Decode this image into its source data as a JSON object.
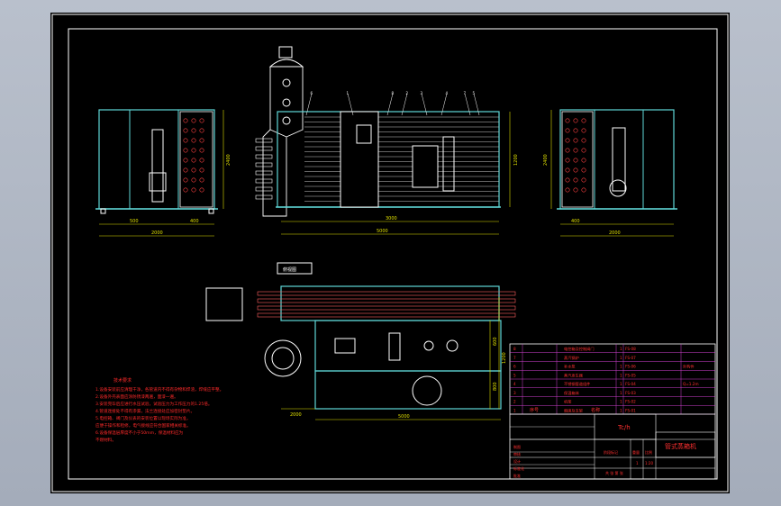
{
  "title_block": {
    "rate_text": "Tc/h",
    "drawing_name": "管式蒸箱机",
    "scale": "1:20",
    "sheet_no": "1",
    "header_labels": [
      "序号",
      "名称"
    ],
    "footer_labels": [
      "制图",
      "审核",
      "设计",
      "标准化",
      "批准"
    ],
    "stage_label": "阶段标记",
    "weight_label": "重量",
    "scale_label": "比例",
    "sheet_label": "共  张  第  张"
  },
  "parts_list": [
    {
      "no": "8",
      "name": "电控箱及控制阀门",
      "code": "FS-08",
      "qty": "1",
      "note": ""
    },
    {
      "no": "7",
      "name": "蒸汽锅炉",
      "code": "FS-07",
      "qty": "1",
      "note": ""
    },
    {
      "no": "6",
      "name": "补水泵",
      "code": "FS-06",
      "qty": "1",
      "note": "外购件"
    },
    {
      "no": "5",
      "name": "蒸汽发生器",
      "code": "FS-05",
      "qty": "1",
      "note": ""
    },
    {
      "no": "4",
      "name": "不锈钢管道组件",
      "code": "FS-04",
      "qty": "1",
      "note": "Q=1.2m"
    },
    {
      "no": "3",
      "name": "保温箱体",
      "code": "FS-03",
      "qty": "1",
      "note": ""
    },
    {
      "no": "2",
      "name": "机架",
      "code": "FS-02",
      "qty": "1",
      "note": ""
    },
    {
      "no": "1",
      "name": "烟囱及支架",
      "code": "FS-01",
      "qty": "1",
      "note": ""
    }
  ],
  "notes": {
    "heading": "技术要求",
    "lines": [
      "1.设备安装前应清理干净，各管道内不得有杂物和焊渣，焊缝应平整。",
      "2.设备外壳表面应涂防锈漆两遍，面漆一遍。",
      "3.安装完毕后应进行水压试验，试验压力为工作压力的1.25倍。",
      "4.管道连接处不得有渗漏，法兰连接处应加密封垫片。",
      "5.电控箱、阀门及仪表的安装位置以现场实际为准，",
      "  应便于操作和检修，电气接线应符合国家相关标准。",
      "6.设备保温层厚度不小于50mm，保温材料应为",
      "  不燃材料。"
    ]
  },
  "view_labels": {
    "top_view_tag": "俯视图",
    "side_box_tag": ""
  },
  "dimensions": {
    "left_width": "2000",
    "left_d1": "500",
    "left_d2": "400",
    "left_height": "2400",
    "front_length": "5000",
    "front_sub": "3000",
    "front_height": "1200",
    "right_width": "2000",
    "right_d1": "400",
    "right_height": "2400",
    "plan_length": "5000",
    "plan_side": "2000",
    "plan_h1": "1200",
    "plan_h2": "800",
    "plan_h3": "600"
  },
  "balloons": [
    "1",
    "2",
    "3",
    "4",
    "5",
    "6",
    "7",
    "8"
  ],
  "colors": {
    "frame": "#ffffff",
    "structure": "#5fd7d7",
    "equipment": "#ffffff",
    "dimension": "#e0e000",
    "text_notes": "#ff2a2a",
    "table_line": "#d040d0",
    "table_text": "#ff3030",
    "accent_red": "#ff2020"
  }
}
